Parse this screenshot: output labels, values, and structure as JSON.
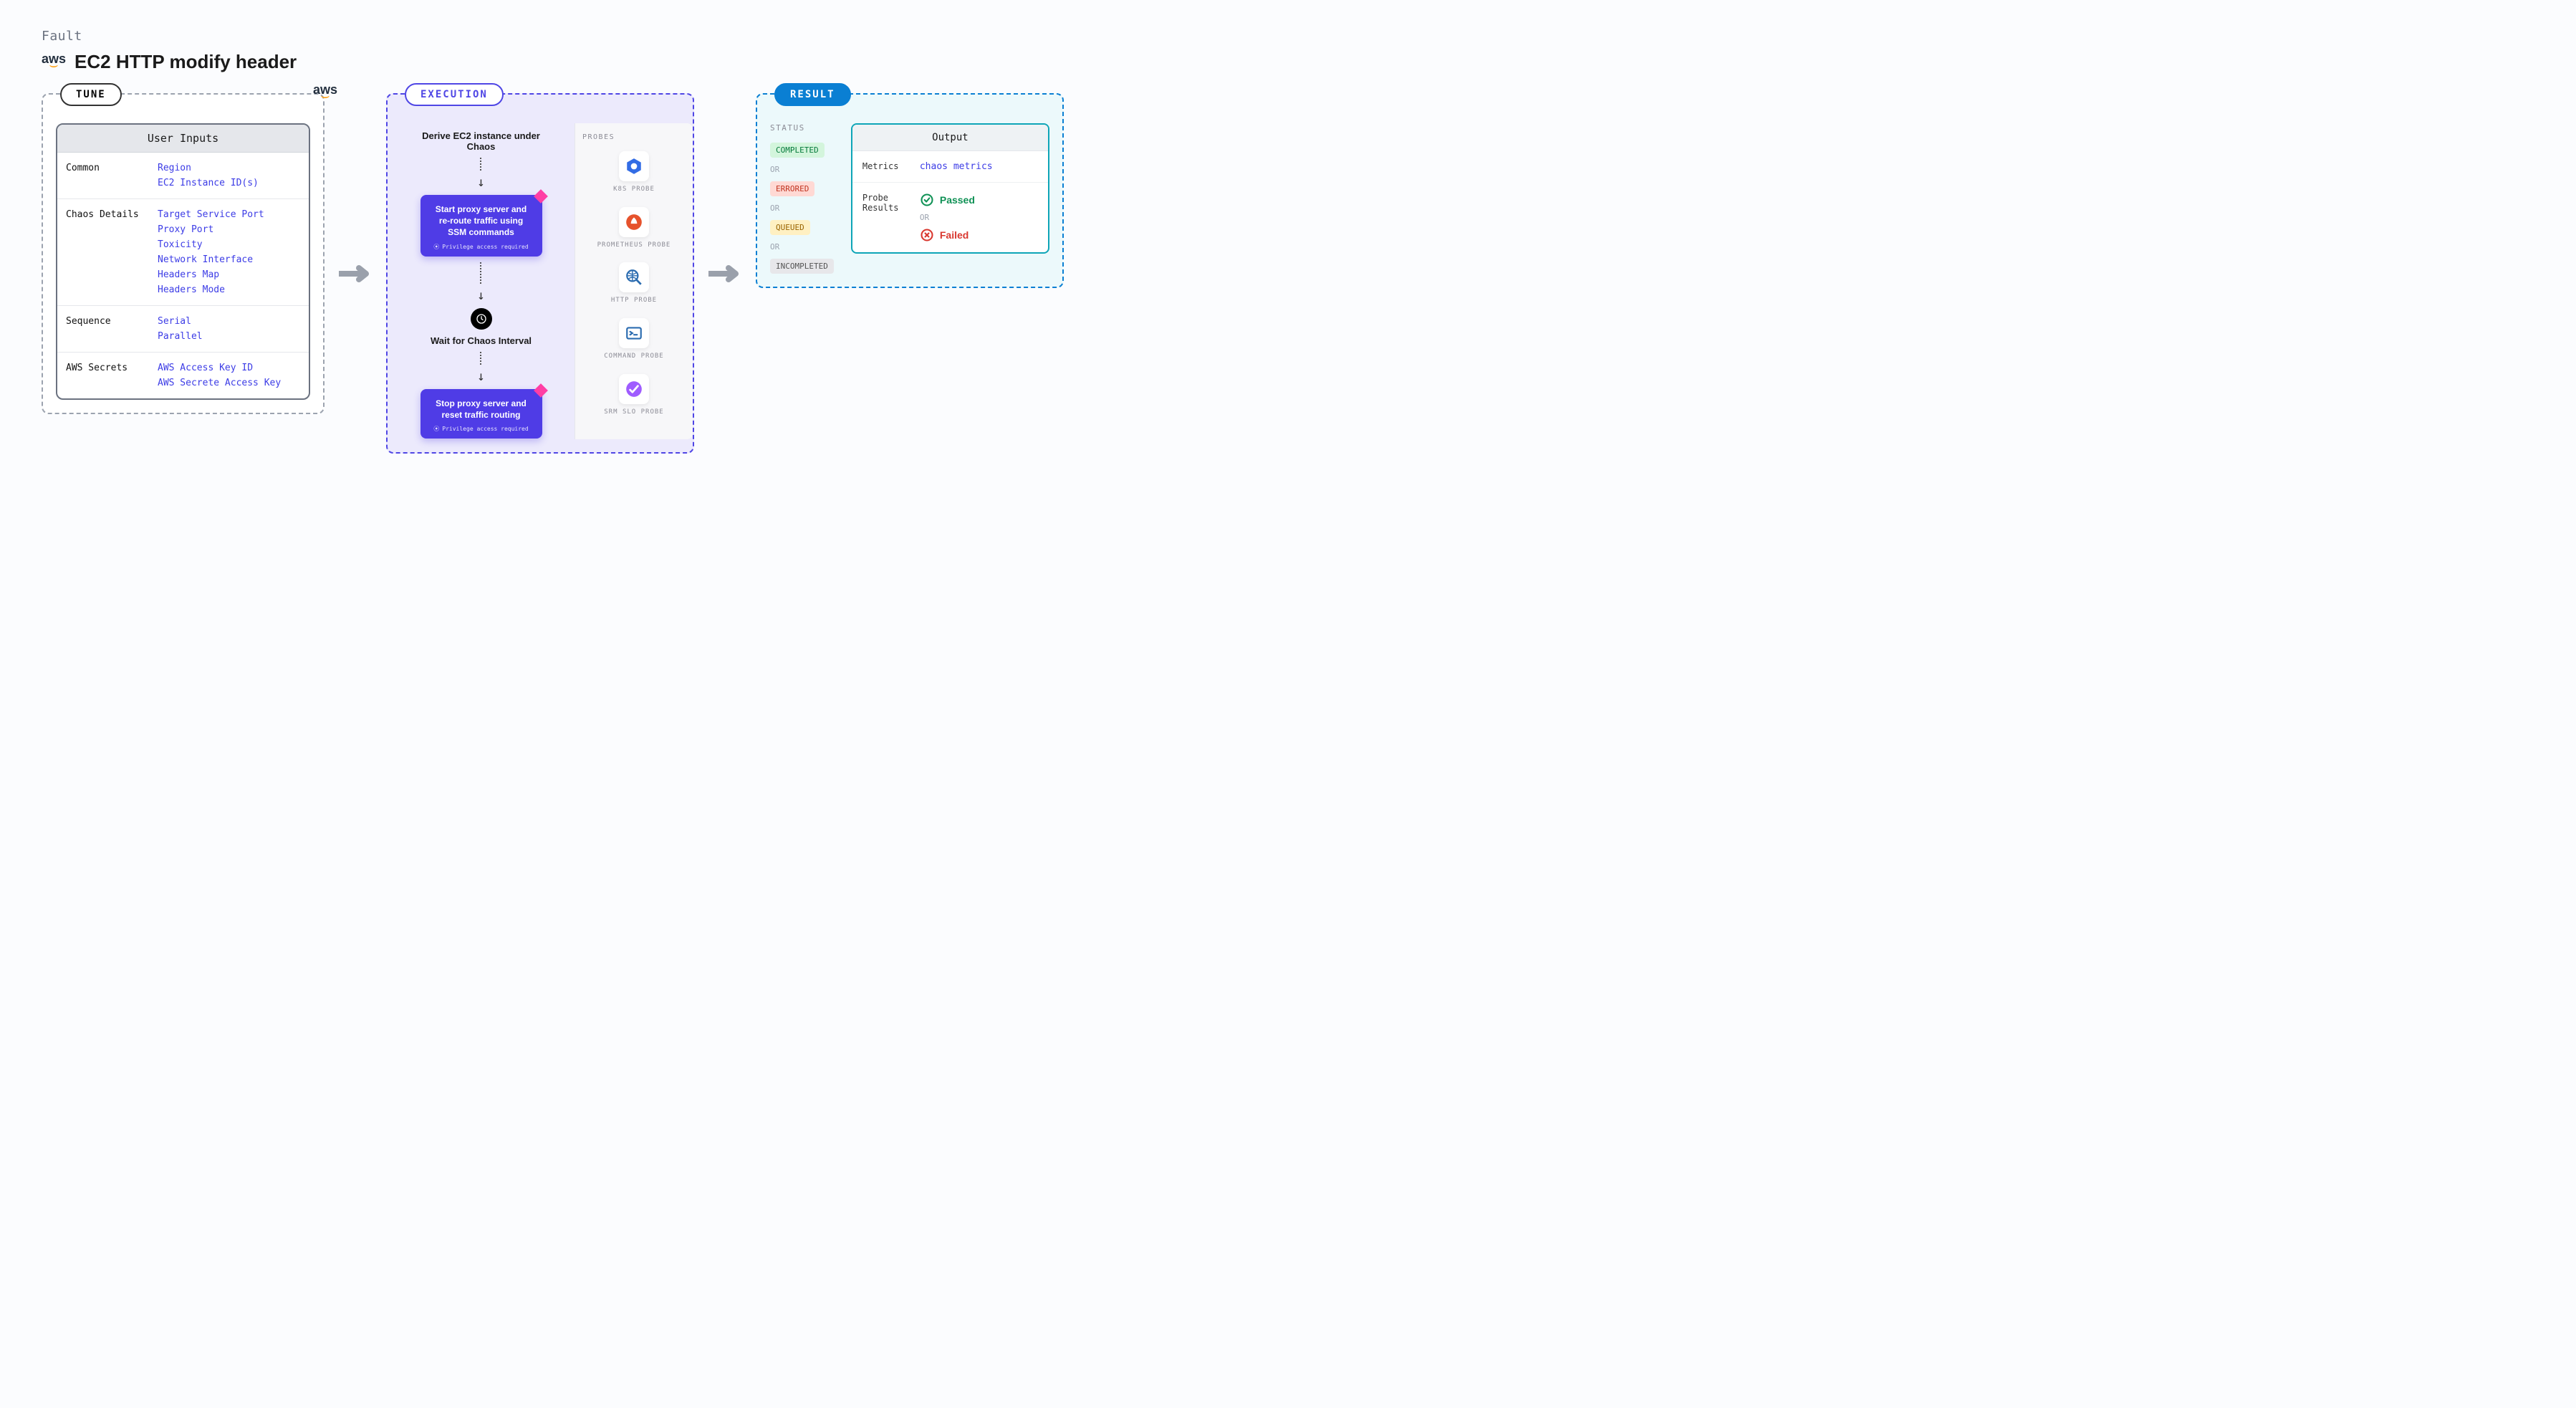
{
  "header": {
    "fault_label": "Fault",
    "title": "EC2 HTTP modify header",
    "aws_logo_text": "aws"
  },
  "tune": {
    "badge": "TUNE",
    "panel_title": "User Inputs",
    "groups": [
      {
        "label": "Common",
        "items": [
          "Region",
          "EC2 Instance ID(s)"
        ]
      },
      {
        "label": "Chaos Details",
        "items": [
          "Target Service Port",
          "Proxy Port",
          "Toxicity",
          "Network Interface",
          "Headers Map",
          "Headers Mode"
        ]
      },
      {
        "label": "Sequence",
        "items": [
          "Serial",
          "Parallel"
        ]
      },
      {
        "label": "AWS Secrets",
        "items": [
          "AWS Access Key ID",
          "AWS Secrete Access Key"
        ]
      }
    ]
  },
  "execution": {
    "badge": "EXECUTION",
    "step1": "Derive EC2 instance under Chaos",
    "card1": "Start proxy server and re-route traffic using SSM commands",
    "privilege_text": "Privilege access required",
    "wait_text": "Wait for Chaos Interval",
    "card2": "Stop proxy server and reset traffic routing"
  },
  "probes": {
    "title": "PROBES",
    "items": [
      {
        "label": "K8S PROBE",
        "icon": "k8s",
        "color": "#326ce5"
      },
      {
        "label": "PROMETHEUS PROBE",
        "icon": "prometheus",
        "color": "#e6522c"
      },
      {
        "label": "HTTP PROBE",
        "icon": "http",
        "color": "#2b6cb0"
      },
      {
        "label": "COMMAND PROBE",
        "icon": "cmd",
        "color": "#2b6cb0"
      },
      {
        "label": "SRM SLO PROBE",
        "icon": "srm",
        "color": "#9f5cff"
      }
    ]
  },
  "result": {
    "badge": "RESULT",
    "status_title": "STATUS",
    "or": "OR",
    "statuses": [
      "COMPLETED",
      "ERRORED",
      "QUEUED",
      "INCOMPLETED"
    ],
    "output_title": "Output",
    "metrics_label": "Metrics",
    "metrics_value": "chaos metrics",
    "probe_results_label": "Probe Results",
    "passed": "Passed",
    "failed": "Failed"
  }
}
